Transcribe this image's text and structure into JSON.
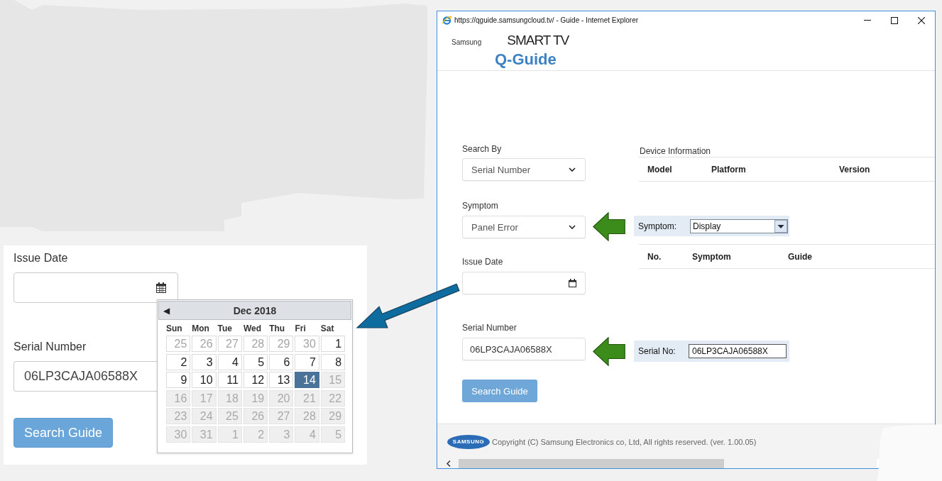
{
  "left_panel": {
    "issue_date": {
      "label": "Issue Date"
    },
    "serial_number": {
      "label": "Serial Number",
      "value": "06LP3CAJA06588X"
    },
    "button": "Search Guide",
    "calendar": {
      "prev": "◀",
      "title": "Dec 2018",
      "weekdays": [
        "Sun",
        "Mon",
        "Tue",
        "Wed",
        "Thu",
        "Fri",
        "Sat"
      ],
      "weeks": [
        [
          {
            "day": "25",
            "kind": "outside",
            "selected": false
          },
          {
            "day": "26",
            "kind": "outside",
            "selected": false
          },
          {
            "day": "27",
            "kind": "outside",
            "selected": false
          },
          {
            "day": "28",
            "kind": "outside",
            "selected": false
          },
          {
            "day": "29",
            "kind": "outside",
            "selected": false
          },
          {
            "day": "30",
            "kind": "outside",
            "selected": false
          },
          {
            "day": "1",
            "kind": "normal",
            "selected": false
          }
        ],
        [
          {
            "day": "2",
            "kind": "normal",
            "selected": false
          },
          {
            "day": "3",
            "kind": "normal",
            "selected": false
          },
          {
            "day": "4",
            "kind": "normal",
            "selected": false
          },
          {
            "day": "5",
            "kind": "normal",
            "selected": false
          },
          {
            "day": "6",
            "kind": "normal",
            "selected": false
          },
          {
            "day": "7",
            "kind": "normal",
            "selected": false
          },
          {
            "day": "8",
            "kind": "normal",
            "selected": false
          }
        ],
        [
          {
            "day": "9",
            "kind": "normal",
            "selected": false
          },
          {
            "day": "10",
            "kind": "normal",
            "selected": false
          },
          {
            "day": "11",
            "kind": "normal",
            "selected": false
          },
          {
            "day": "12",
            "kind": "normal",
            "selected": false
          },
          {
            "day": "13",
            "kind": "normal",
            "selected": false
          },
          {
            "day": "14",
            "kind": "normal",
            "selected": true
          },
          {
            "day": "15",
            "kind": "disabled",
            "selected": false
          }
        ],
        [
          {
            "day": "16",
            "kind": "disabled",
            "selected": false
          },
          {
            "day": "17",
            "kind": "disabled",
            "selected": false
          },
          {
            "day": "18",
            "kind": "disabled",
            "selected": false
          },
          {
            "day": "19",
            "kind": "disabled",
            "selected": false
          },
          {
            "day": "20",
            "kind": "disabled",
            "selected": false
          },
          {
            "day": "21",
            "kind": "disabled",
            "selected": false
          },
          {
            "day": "22",
            "kind": "disabled",
            "selected": false
          }
        ],
        [
          {
            "day": "23",
            "kind": "disabled",
            "selected": false
          },
          {
            "day": "24",
            "kind": "disabled",
            "selected": false
          },
          {
            "day": "25",
            "kind": "disabled",
            "selected": false
          },
          {
            "day": "26",
            "kind": "disabled",
            "selected": false
          },
          {
            "day": "27",
            "kind": "disabled",
            "selected": false
          },
          {
            "day": "28",
            "kind": "disabled",
            "selected": false
          },
          {
            "day": "29",
            "kind": "disabled",
            "selected": false
          }
        ],
        [
          {
            "day": "30",
            "kind": "disabled",
            "selected": false
          },
          {
            "day": "31",
            "kind": "disabled",
            "selected": false
          },
          {
            "day": "1",
            "kind": "disabled",
            "selected": false
          },
          {
            "day": "2",
            "kind": "disabled",
            "selected": false
          },
          {
            "day": "3",
            "kind": "disabled",
            "selected": false
          },
          {
            "day": "4",
            "kind": "disabled",
            "selected": false
          },
          {
            "day": "5",
            "kind": "disabled",
            "selected": false
          }
        ]
      ]
    }
  },
  "browser": {
    "title": "https://qguide.samsungcloud.tv/ - Guide - Internet Explorer",
    "header": {
      "brand": "Samsung",
      "product": "SMART TV",
      "app": "Q-Guide"
    },
    "form": {
      "search_by": {
        "label": "Search By",
        "value": "Serial Number"
      },
      "symptom": {
        "label": "Symptom",
        "value": "Panel Error"
      },
      "issue_date": {
        "label": "Issue Date"
      },
      "serial_number": {
        "label": "Serial Number",
        "value": "06LP3CAJA06588X"
      },
      "button": "Search Guide"
    },
    "device_info": {
      "title": "Device Information",
      "columns": [
        "Model",
        "Platform",
        "Version"
      ]
    },
    "symptom_callout": {
      "label": "Symptom:",
      "value": "Display"
    },
    "symptom_table": {
      "columns": [
        "No.",
        "Symptom",
        "Guide"
      ]
    },
    "serial_callout": {
      "label": "Serial No:",
      "value": "06LP3CAJA06588X"
    },
    "footer": {
      "logo": "SAMSUNG",
      "copyright": "Copyright (C) Samsung Electronics co, Ltd, All rights reserved. (ver. 1.00.05)"
    }
  }
}
